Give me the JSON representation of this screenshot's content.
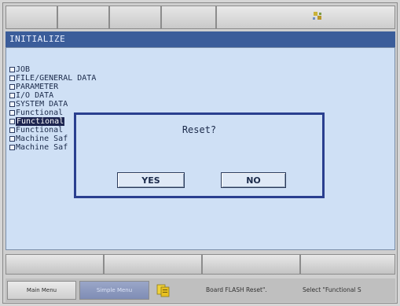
{
  "title": "INITIALIZE",
  "menu": {
    "items": [
      {
        "label": "JOB"
      },
      {
        "label": "FILE/GENERAL DATA"
      },
      {
        "label": "PARAMETER"
      },
      {
        "label": "I/O DATA"
      },
      {
        "label": "SYSTEM DATA"
      },
      {
        "label": "Functional"
      },
      {
        "label": "Functional"
      },
      {
        "label": "Functional"
      },
      {
        "label": "Machine Saf"
      },
      {
        "label": "Machine Saf"
      }
    ]
  },
  "dialog": {
    "title": "Reset?",
    "yes_label": "YES",
    "no_label": "NO"
  },
  "bottom": {
    "main_menu": "Main Menu",
    "simple_menu": "Simple Menu",
    "hint1": "Board FLASH Reset\".",
    "hint2": "Select \"Functional S"
  },
  "colors": {
    "title_bar": "#3b5d9a",
    "main_bg": "#cfe0f5",
    "dialog_border": "#2a3f8f",
    "selected_bg": "#1d2550",
    "simple_menu_bg": "#8794bd"
  },
  "icons": {
    "status": "status-indicator-icon",
    "clipboard": "clipboard-icon"
  }
}
